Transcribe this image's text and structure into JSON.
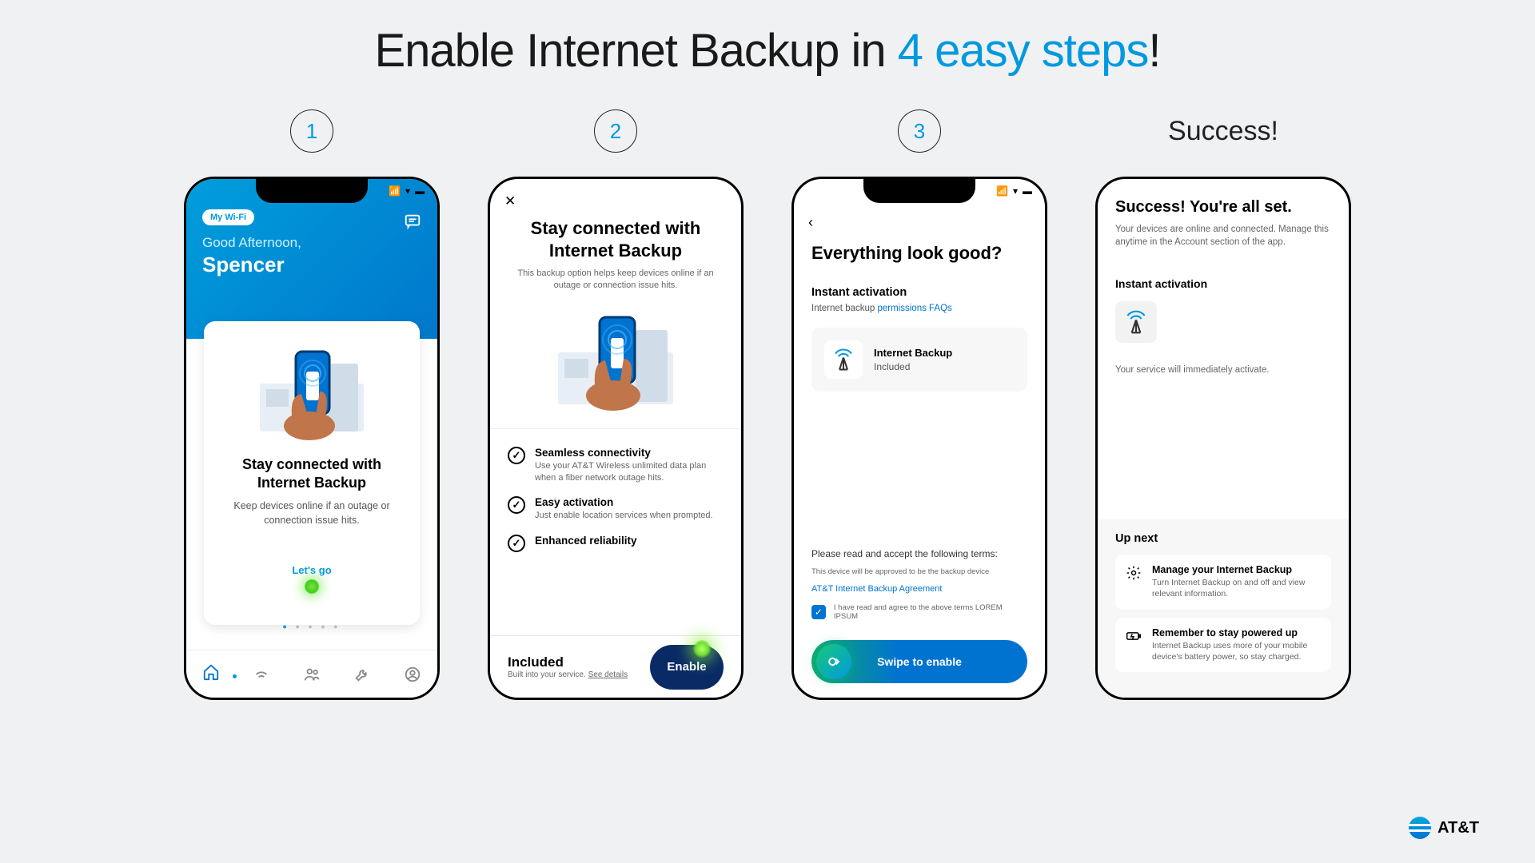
{
  "page": {
    "title_prefix": "Enable Internet Backup in ",
    "title_accent": "4 easy steps",
    "title_suffix": "!"
  },
  "steps": {
    "s1": "1",
    "s2": "2",
    "s3": "3",
    "success": "Success!"
  },
  "phone1": {
    "wifi_pill": "My Wi-Fi",
    "greeting": "Good Afternoon,",
    "name": "Spencer",
    "card_title": "Stay connected with Internet Backup",
    "card_desc": "Keep devices online if an outage or connection issue hits.",
    "cta": "Let's go"
  },
  "phone2": {
    "title": "Stay connected with Internet Backup",
    "subtitle": "This backup option helps keep devices online if an outage or connection issue hits.",
    "feat1_t": "Seamless connectivity",
    "feat1_d": "Use your AT&T Wireless unlimited data plan when a fiber network outage hits.",
    "feat2_t": "Easy activation",
    "feat2_d": "Just enable location services when prompted.",
    "feat3_t": "Enhanced reliability",
    "included": "Included",
    "built_in": "Built into your service. ",
    "see_details": "See details",
    "enable": "Enable"
  },
  "phone3": {
    "title": "Everything look good?",
    "section": "Instant activation",
    "faq_prefix": "Internet backup ",
    "faq_link": "permissions FAQs",
    "card_t": "Internet Backup",
    "card_s": "Included",
    "terms_lbl": "Please read and accept the following terms:",
    "terms_line": "This device will be approved to be the backup device",
    "agreement": "AT&T Internet Backup Agreement",
    "consent": "I have read and agree to the above terms LOREM IPSUM",
    "swipe": "Swipe to enable"
  },
  "phone4": {
    "title": "Success! You're all set.",
    "subtitle": "Your devices are online and connected. Manage this anytime in the Account section of the app.",
    "section": "Instant activation",
    "note": "Your service will immediately activate.",
    "upnext": "Up next",
    "item1_t": "Manage your Internet Backup",
    "item1_d": "Turn Internet Backup on and off and view relevant information.",
    "item2_t": "Remember to stay powered up",
    "item2_d": "Internet Backup uses more of your mobile device's battery power, so stay charged."
  },
  "brand": "AT&T"
}
